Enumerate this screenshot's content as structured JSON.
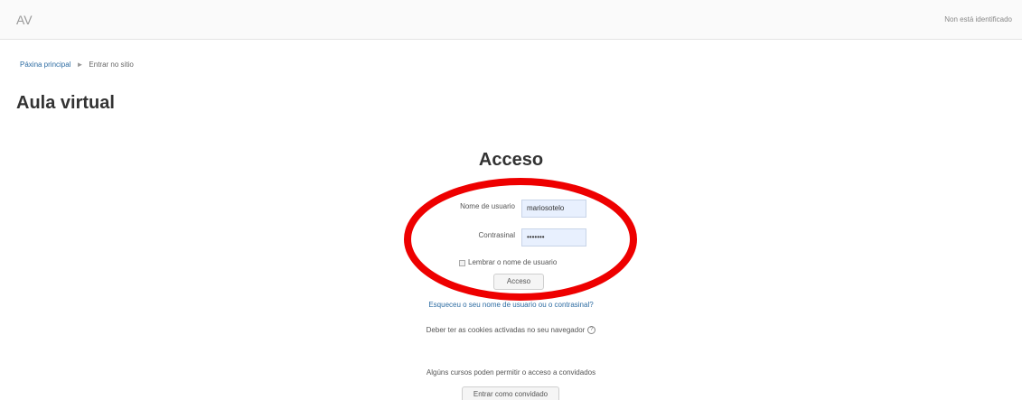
{
  "navbar": {
    "brand": "AV",
    "login_info": "Non está identificado"
  },
  "breadcrumb": {
    "home": "Páxina principal",
    "separator": "►",
    "current": "Entrar no sitio"
  },
  "page_title": "Aula virtual",
  "login": {
    "heading": "Acceso",
    "username_label": "Nome de usuario",
    "username_value": "mariosotelo",
    "password_label": "Contrasinal",
    "password_value": "•••••••",
    "remember_label": "Lembrar o nome de usuario",
    "remember_checked": false,
    "submit_label": "Acceso",
    "forgot_link": "Esqueceu o seu nome de usuario ou o contrasinal?",
    "cookies_note": "Deber ter as cookies activadas no seu navegador",
    "help_icon_glyph": "?"
  },
  "guest": {
    "note": "Algúns cursos poden permitir o acceso a convidados",
    "button_label": "Entrar como convidado"
  },
  "annotation": {
    "color": "#ee0000"
  }
}
